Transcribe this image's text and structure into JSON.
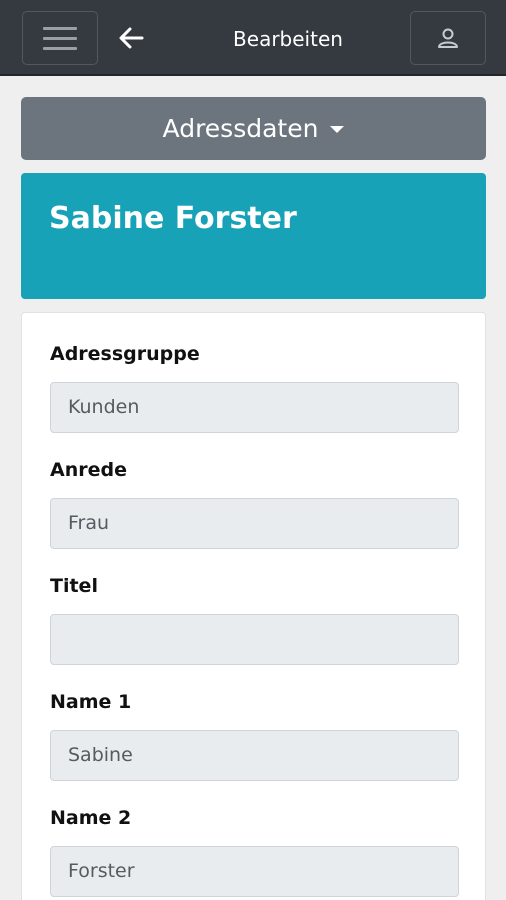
{
  "header": {
    "title": "Bearbeiten"
  },
  "section_dropdown": {
    "label": "Adressdaten"
  },
  "contact": {
    "name": "Sabine Forster"
  },
  "form": {
    "fields": [
      {
        "label": "Adressgruppe",
        "value": "Kunden"
      },
      {
        "label": "Anrede",
        "value": "Frau"
      },
      {
        "label": "Titel",
        "value": ""
      },
      {
        "label": "Name 1",
        "value": "Sabine"
      },
      {
        "label": "Name 2",
        "value": "Forster"
      }
    ]
  }
}
